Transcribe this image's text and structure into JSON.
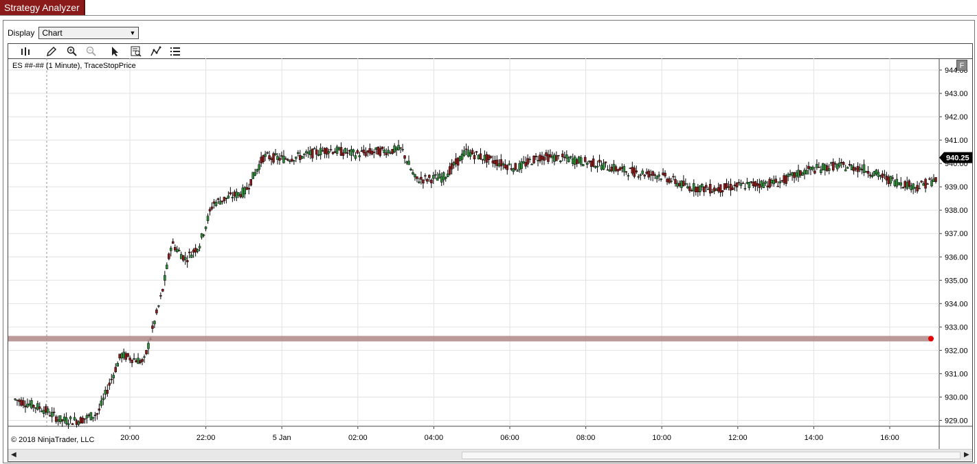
{
  "window": {
    "tab_label": "Strategy Analyzer"
  },
  "display": {
    "label": "Display",
    "selected": "Chart"
  },
  "toolbar": {
    "buttons": [
      {
        "name": "bar-chart-icon"
      },
      {
        "name": "pencil-icon"
      },
      {
        "name": "zoom-in-icon"
      },
      {
        "name": "zoom-out-icon"
      },
      {
        "name": "pointer-icon"
      },
      {
        "name": "data-box-icon"
      },
      {
        "name": "indicators-icon"
      },
      {
        "name": "properties-list-icon"
      }
    ]
  },
  "chart": {
    "instrument_title": "ES ##-## (1 Minute), TraceStopPrice",
    "copyright": "© 2018 NinjaTrader, LLC",
    "f_button": "F",
    "last_price_label": "940.25",
    "colors": {
      "up": "#2e8b3a",
      "down": "#8b1a1a",
      "stop_line": "#b08888",
      "stop_dot": "#e60000",
      "grid": "#e2e2e2"
    }
  },
  "chart_data": {
    "type": "candlestick",
    "title": "ES ##-## (1 Minute), TraceStopPrice",
    "ylim": [
      928.75,
      944.5
    ],
    "yticks": [
      "944.00",
      "943.00",
      "942.00",
      "941.00",
      "940.00",
      "939.00",
      "938.00",
      "937.00",
      "936.00",
      "935.00",
      "934.00",
      "933.00",
      "932.00",
      "931.00",
      "930.00",
      "929.00"
    ],
    "xticks": [
      "20:00",
      "22:00",
      "5 Jan",
      "02:00",
      "04:00",
      "06:00",
      "08:00",
      "10:00",
      "12:00",
      "14:00",
      "16:00"
    ],
    "last_price": 940.25,
    "trace_stop_price": 932.5,
    "price_path": [
      {
        "x": 0.0,
        "y": 929.9
      },
      {
        "x": 0.03,
        "y": 929.5
      },
      {
        "x": 0.05,
        "y": 929.0
      },
      {
        "x": 0.07,
        "y": 929.0
      },
      {
        "x": 0.09,
        "y": 929.3
      },
      {
        "x": 0.115,
        "y": 931.8
      },
      {
        "x": 0.14,
        "y": 931.5
      },
      {
        "x": 0.16,
        "y": 934.5
      },
      {
        "x": 0.17,
        "y": 936.6
      },
      {
        "x": 0.185,
        "y": 935.9
      },
      {
        "x": 0.2,
        "y": 936.5
      },
      {
        "x": 0.215,
        "y": 938.3
      },
      {
        "x": 0.25,
        "y": 938.8
      },
      {
        "x": 0.27,
        "y": 940.3
      },
      {
        "x": 0.29,
        "y": 940.2
      },
      {
        "x": 0.31,
        "y": 940.3
      },
      {
        "x": 0.34,
        "y": 940.6
      },
      {
        "x": 0.37,
        "y": 940.4
      },
      {
        "x": 0.39,
        "y": 940.5
      },
      {
        "x": 0.42,
        "y": 940.6
      },
      {
        "x": 0.435,
        "y": 939.3
      },
      {
        "x": 0.465,
        "y": 939.4
      },
      {
        "x": 0.49,
        "y": 940.5
      },
      {
        "x": 0.52,
        "y": 940.1
      },
      {
        "x": 0.545,
        "y": 939.8
      },
      {
        "x": 0.57,
        "y": 940.3
      },
      {
        "x": 0.6,
        "y": 940.2
      },
      {
        "x": 0.63,
        "y": 940.0
      },
      {
        "x": 0.66,
        "y": 939.7
      },
      {
        "x": 0.7,
        "y": 939.5
      },
      {
        "x": 0.73,
        "y": 939.0
      },
      {
        "x": 0.76,
        "y": 938.9
      },
      {
        "x": 0.8,
        "y": 939.1
      },
      {
        "x": 0.83,
        "y": 939.2
      },
      {
        "x": 0.86,
        "y": 939.7
      },
      {
        "x": 0.89,
        "y": 939.9
      },
      {
        "x": 0.92,
        "y": 939.8
      },
      {
        "x": 0.95,
        "y": 939.3
      },
      {
        "x": 0.98,
        "y": 939.0
      },
      {
        "x": 1.0,
        "y": 939.3
      }
    ]
  }
}
